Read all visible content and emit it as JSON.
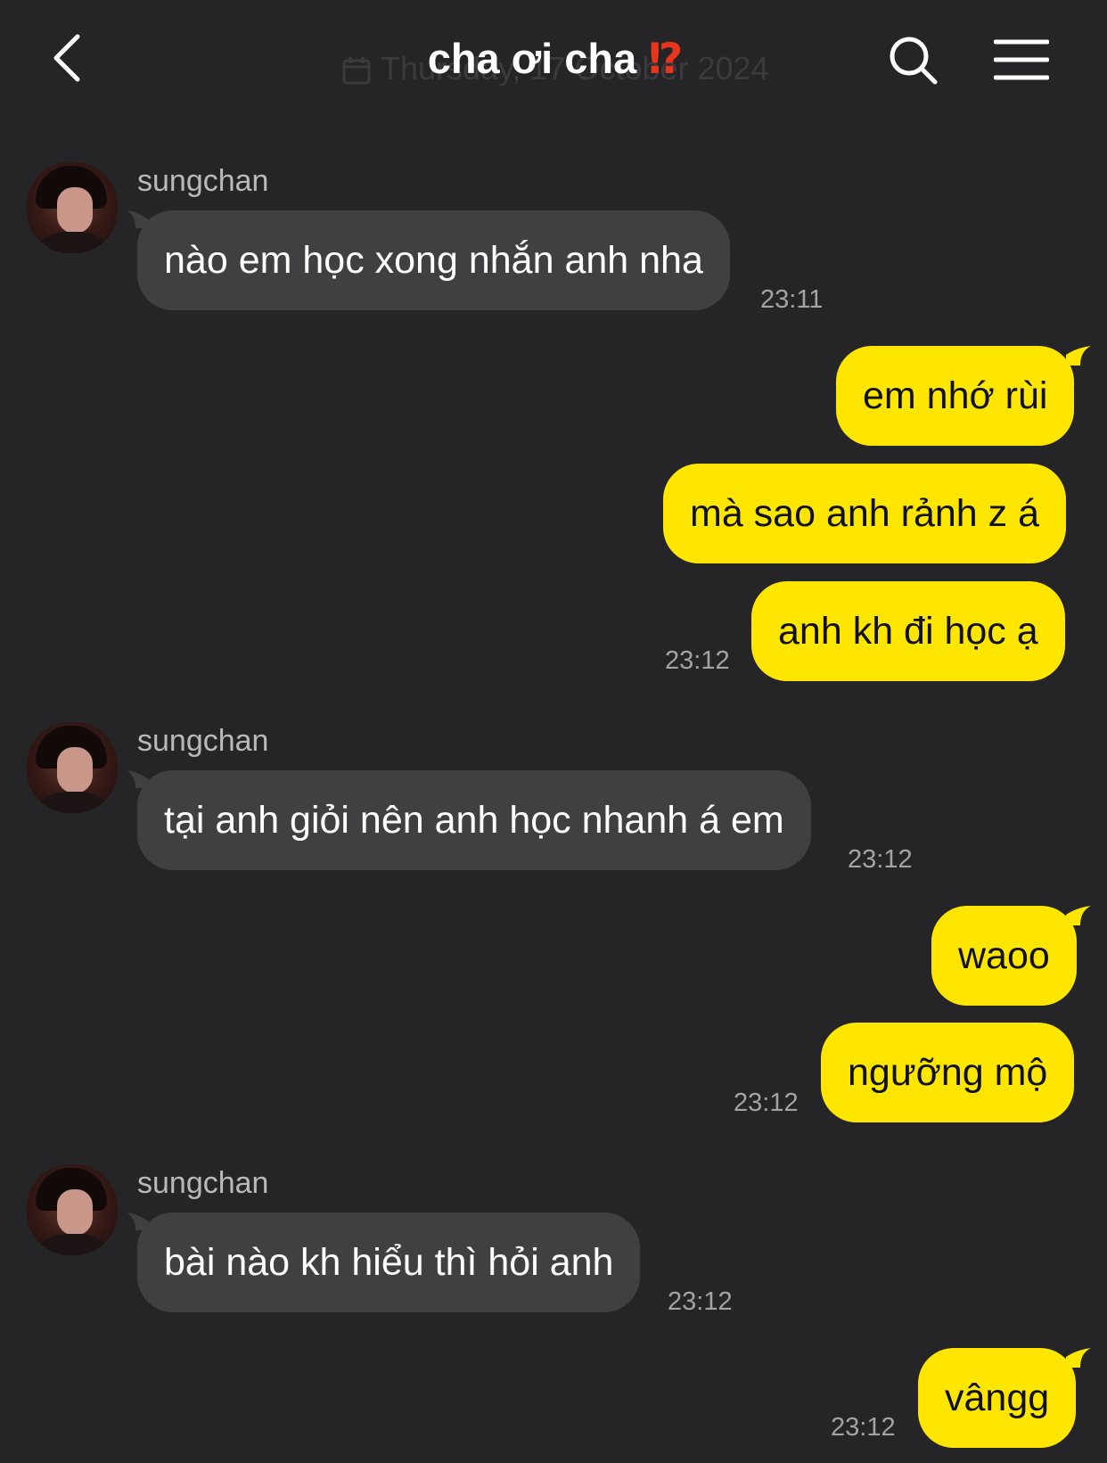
{
  "header": {
    "title": "cha ơi cha",
    "title_emoji": "⁉",
    "date": "Thursday, 17 October 2024",
    "back_icon": "chevron-left-icon",
    "search_icon": "search-icon",
    "menu_icon": "menu-icon"
  },
  "colors": {
    "background": "#252527",
    "incoming_bubble": "#404043",
    "outgoing_bubble": "#ffe600",
    "timestamp": "#a3a3a7"
  },
  "messages": [
    {
      "from": "sungchan",
      "text": "nào em học xong nhắn anh nha",
      "time": "23:11"
    },
    {
      "from": "me",
      "text": "em nhớ rùi"
    },
    {
      "from": "me",
      "text": "mà sao anh rảnh z á"
    },
    {
      "from": "me",
      "text": "anh kh đi học ạ",
      "time": "23:12"
    },
    {
      "from": "sungchan",
      "text": "tại anh giỏi nên anh học nhanh á em",
      "time": "23:12"
    },
    {
      "from": "me",
      "text": "waoo"
    },
    {
      "from": "me",
      "text": "ngưỡng mộ",
      "time": "23:12"
    },
    {
      "from": "sungchan",
      "text": "bài nào kh hiểu thì hỏi anh",
      "time": "23:12"
    },
    {
      "from": "me",
      "text": "vângg",
      "time": "23:12"
    }
  ]
}
